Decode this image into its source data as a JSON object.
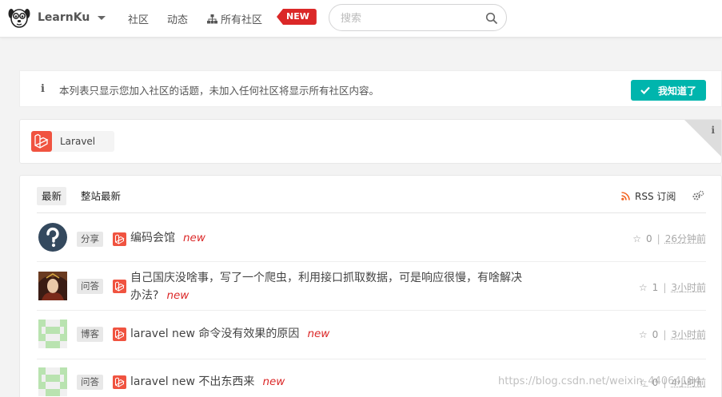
{
  "navbar": {
    "brand": "LearnKu",
    "community": "社区",
    "dynamic": "动态",
    "all_communities": "所有社区",
    "new_badge": "NEW",
    "search_placeholder": "搜索"
  },
  "info": {
    "text": "本列表只显示您加入社区的话题，未加入任何社区将显示所有社区内容。",
    "ack_button": "我知道了"
  },
  "tags": {
    "items": [
      {
        "label": "Laravel"
      }
    ]
  },
  "topics": {
    "tab_latest": "最新",
    "tab_sitewide": "整站最新",
    "rss_label": "RSS 订阅",
    "rows": [
      {
        "category": "分享",
        "title": "编码会馆",
        "new_label": "new",
        "votes": "0",
        "time": "26分钟前",
        "avatar": "question-icon"
      },
      {
        "category": "问答",
        "title_line1": "自己国庆没啥事，写了一个爬虫，利用接口抓取数据，可是响应很慢，有啥解决",
        "title_line2": "办法?",
        "new_label": "new",
        "votes": "1",
        "time": "3小时前",
        "avatar": "photo-avatar"
      },
      {
        "category": "博客",
        "title": "laravel new 命令没有效果的原因",
        "new_label": "new",
        "votes": "0",
        "time": "3小时前",
        "avatar": "identicon"
      },
      {
        "category": "问答",
        "title": "laravel new 不出东西来",
        "new_label": "new",
        "votes": "0",
        "time": "4小时前",
        "avatar": "identicon"
      }
    ]
  },
  "watermark": "https://blog.csdn.net/weixin_44064184",
  "colors": {
    "accent_teal": "#00b5ad",
    "new_red": "#db2828",
    "laravel_red": "#f05340"
  }
}
